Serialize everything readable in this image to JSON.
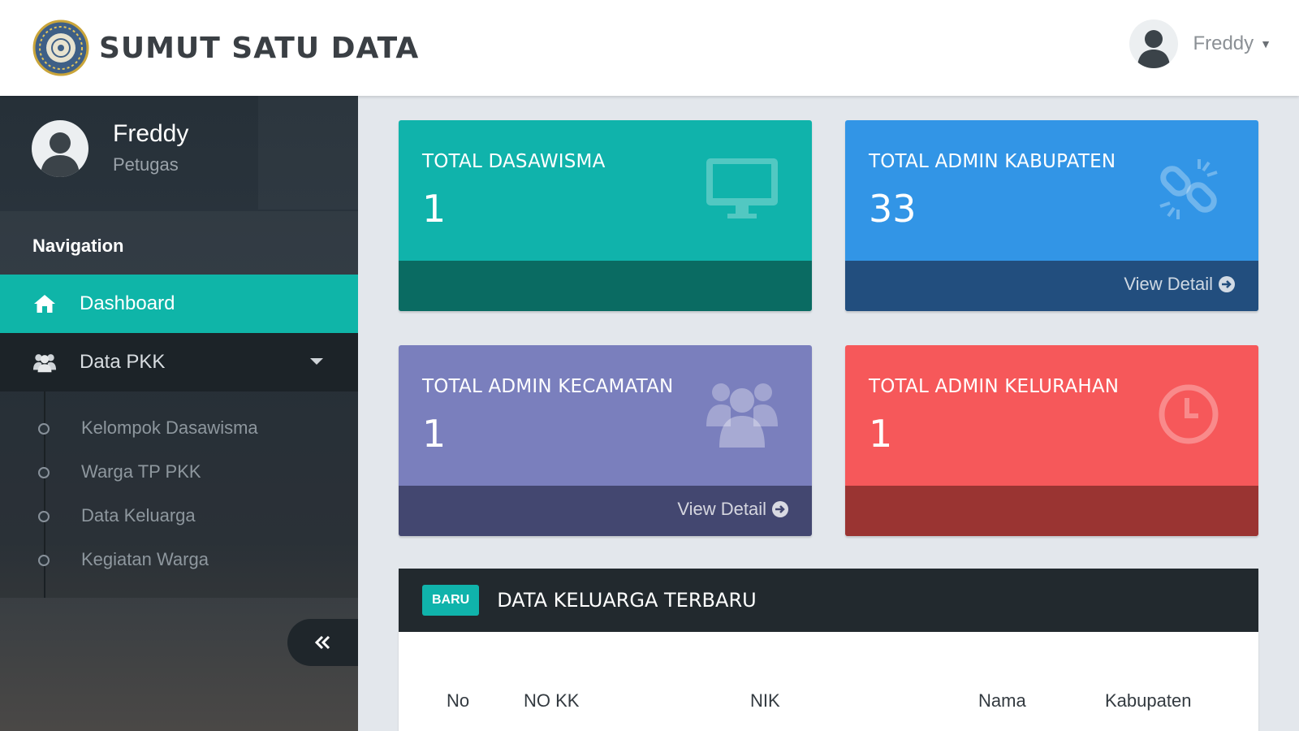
{
  "header": {
    "brand": "SUMUT SATU DATA",
    "user_name": "Freddy"
  },
  "sidebar": {
    "profile": {
      "name": "Freddy",
      "role": "Petugas"
    },
    "nav_header": "Navigation",
    "items": [
      {
        "label": "Dashboard",
        "icon": "home-icon",
        "active": true
      },
      {
        "label": "Data PKK",
        "icon": "users-icon",
        "expanded": true,
        "children": [
          "Kelompok Dasawisma",
          "Warga TP PKK",
          "Data Keluarga",
          "Kegiatan Warga"
        ]
      }
    ]
  },
  "cards": [
    {
      "title": "TOTAL DASAWISMA",
      "value": "1",
      "icon": "monitor-icon",
      "color": "#10b3ab",
      "footer": ""
    },
    {
      "title": "TOTAL ADMIN KABUPATEN",
      "value": "33",
      "icon": "link-broken-icon",
      "color": "#3295e6",
      "footer": "View Detail"
    },
    {
      "title": "TOTAL ADMIN KECAMATAN",
      "value": "1",
      "icon": "group-icon",
      "color": "#7a7fbd",
      "footer": "View Detail"
    },
    {
      "title": "TOTAL ADMIN KELURAHAN",
      "value": "1",
      "icon": "clock-icon",
      "color": "#f6585a",
      "footer": ""
    }
  ],
  "table_panel": {
    "badge": "BARU",
    "title": "DATA KELUARGA TERBARU",
    "columns": [
      "No",
      "NO KK",
      "NIK",
      "Nama",
      "Kabupaten"
    ]
  },
  "colors": {
    "accent": "#10b3ab",
    "sidebar_bg": "#2c363f",
    "panel_head": "#22292e"
  }
}
